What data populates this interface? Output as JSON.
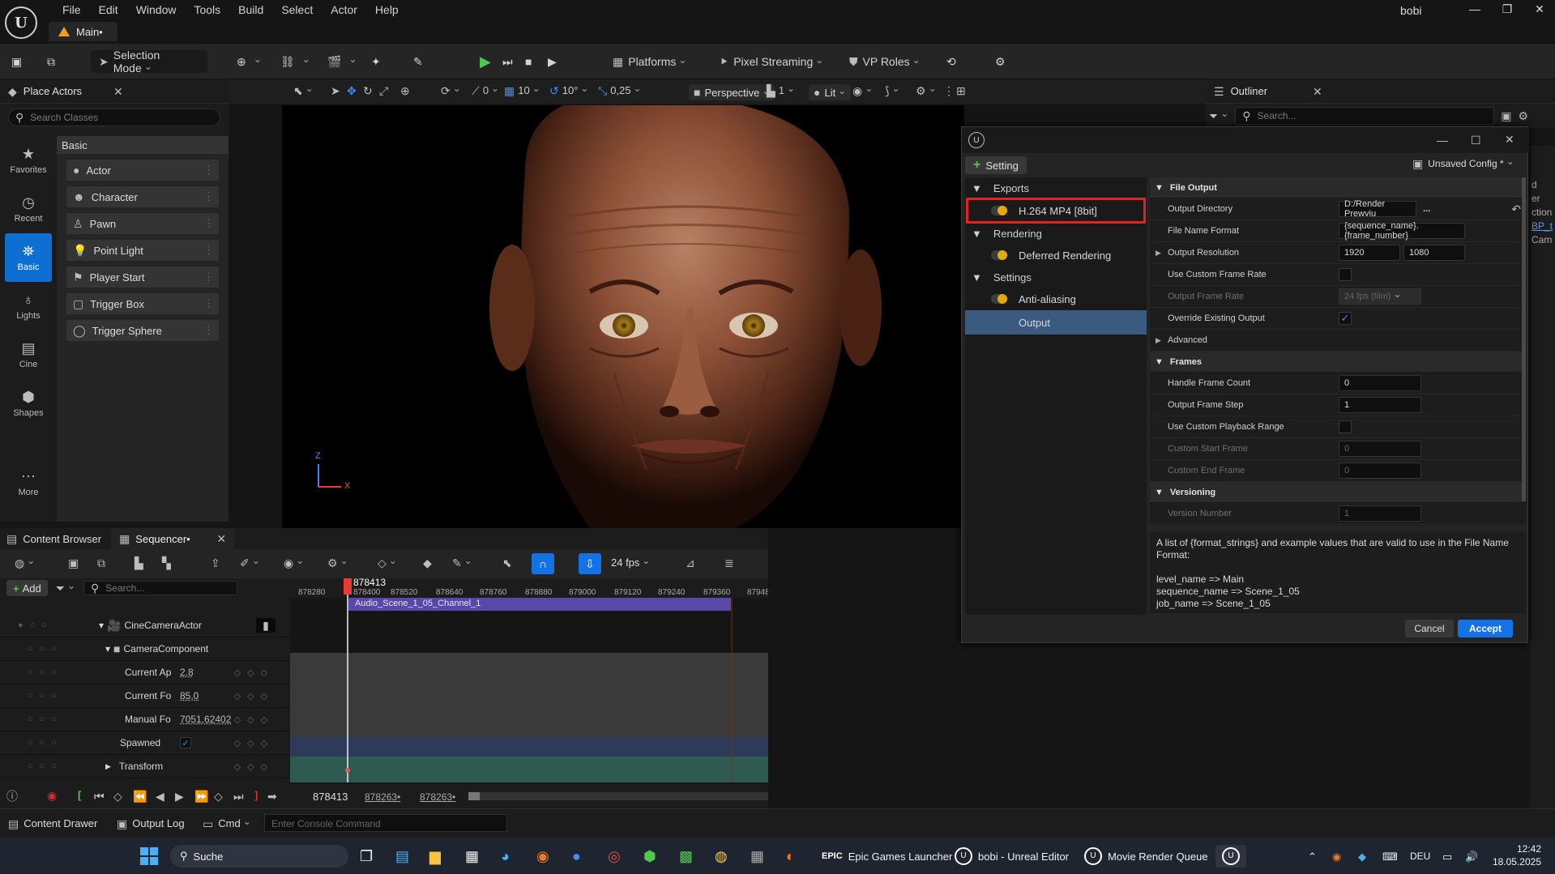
{
  "menubar": {
    "items": [
      "File",
      "Edit",
      "Window",
      "Tools",
      "Build",
      "Select",
      "Actor",
      "Help"
    ],
    "doc_tab": "Main•",
    "user": "bobi"
  },
  "toolbar": {
    "selection_mode": "Selection Mode",
    "platforms": "Platforms",
    "pixel_streaming": "Pixel Streaming",
    "vp_roles": "VP Roles"
  },
  "place_actors": {
    "tab": "Place Actors",
    "search_placeholder": "Search Classes",
    "header": "Basic",
    "categories": [
      "Favorites",
      "Recent",
      "Basic",
      "Lights",
      "Cine",
      "Shapes",
      "More"
    ],
    "actors": [
      "Actor",
      "Character",
      "Pawn",
      "Point Light",
      "Player Start",
      "Trigger Box",
      "Trigger Sphere"
    ]
  },
  "viewport": {
    "snap_grid": "10",
    "snap_rot": "10°",
    "snap_scale": "0,25",
    "zero": "0",
    "view": "Perspective",
    "lit": "Lit",
    "layer": "1",
    "axis_z": "Z",
    "axis_x": "X"
  },
  "outliner": {
    "tab": "Outliner",
    "search_placeholder": "Search...",
    "peek": [
      "d",
      "er",
      "ction",
      "BP_t",
      "Cam"
    ]
  },
  "mrq": {
    "add_setting": "Setting",
    "config": "Unsaved Config *",
    "tree": {
      "exports": "Exports",
      "exports_item": "H.264 MP4 [8bit]",
      "rendering": "Rendering",
      "rendering_item": "Deferred Rendering",
      "settings": "Settings",
      "settings_items": [
        "Anti-aliasing",
        "Output"
      ]
    },
    "file_output": {
      "header": "File Output",
      "output_directory_label": "Output Directory",
      "output_directory": "D:/Render Prewviu",
      "browse": "...",
      "file_name_format_label": "File Name Format",
      "file_name_format": "{sequence_name}.{frame_number}",
      "output_resolution_label": "Output Resolution",
      "res_x": "1920",
      "res_y": "1080",
      "use_custom_frame_rate_label": "Use Custom Frame Rate",
      "output_frame_rate_label": "Output Frame Rate",
      "output_frame_rate": "24 fps (film)",
      "override_label": "Override Existing Output",
      "advanced_label": "Advanced"
    },
    "frames": {
      "header": "Frames",
      "handle_frame_count_label": "Handle Frame Count",
      "handle_frame_count": "0",
      "output_frame_step_label": "Output Frame Step",
      "output_frame_step": "1",
      "use_custom_playback_label": "Use Custom Playback Range",
      "custom_start_label": "Custom Start Frame",
      "custom_start": "0",
      "custom_end_label": "Custom End Frame",
      "custom_end": "0"
    },
    "versioning": {
      "header": "Versioning",
      "version_number_label": "Version Number",
      "version_number": "1"
    },
    "description": "A list of {format_strings} and example values that are valid to use in the File Name Format:\n\nlevel_name => Main\nsequence_name => Scene_1_05\njob_name => Scene_1_05",
    "cancel": "Cancel",
    "accept": "Accept"
  },
  "sequencer": {
    "tab_content_browser": "Content Browser",
    "tab_sequencer": "Sequencer•",
    "add": "Add",
    "search_placeholder": "Search...",
    "fps": "24 fps",
    "playhead": "878413",
    "ticks": [
      "878280",
      "878400",
      "878520",
      "878640",
      "878760",
      "878880",
      "879000",
      "879120",
      "879240",
      "879360",
      "87948"
    ],
    "audio_clip": "Audio_Scene_1_05_Channel_1",
    "tracks": [
      {
        "name": "CineCameraActor",
        "value": ""
      },
      {
        "name": "CameraComponent",
        "value": ""
      },
      {
        "name": "Current Ap",
        "value": "2,8"
      },
      {
        "name": "Current Fo",
        "value": "85,0"
      },
      {
        "name": "Manual Fo",
        "value": "7051,62402"
      },
      {
        "name": "Spawned",
        "value": "✓"
      },
      {
        "name": "Transform",
        "value": ""
      }
    ],
    "current_frame": "878413",
    "range_start": "878263•",
    "range_end": "878263•"
  },
  "statusbar": {
    "content_drawer": "Content Drawer",
    "output_log": "Output Log",
    "cmd": "Cmd",
    "console_placeholder": "Enter Console Command"
  },
  "taskbar": {
    "search": "Suche",
    "epic": "Epic Games Launcher",
    "unreal": "bobi - Unreal Editor",
    "mrq": "Movie Render Queue",
    "lang": "DEU",
    "time": "12:42",
    "date": "18.05.2025"
  }
}
